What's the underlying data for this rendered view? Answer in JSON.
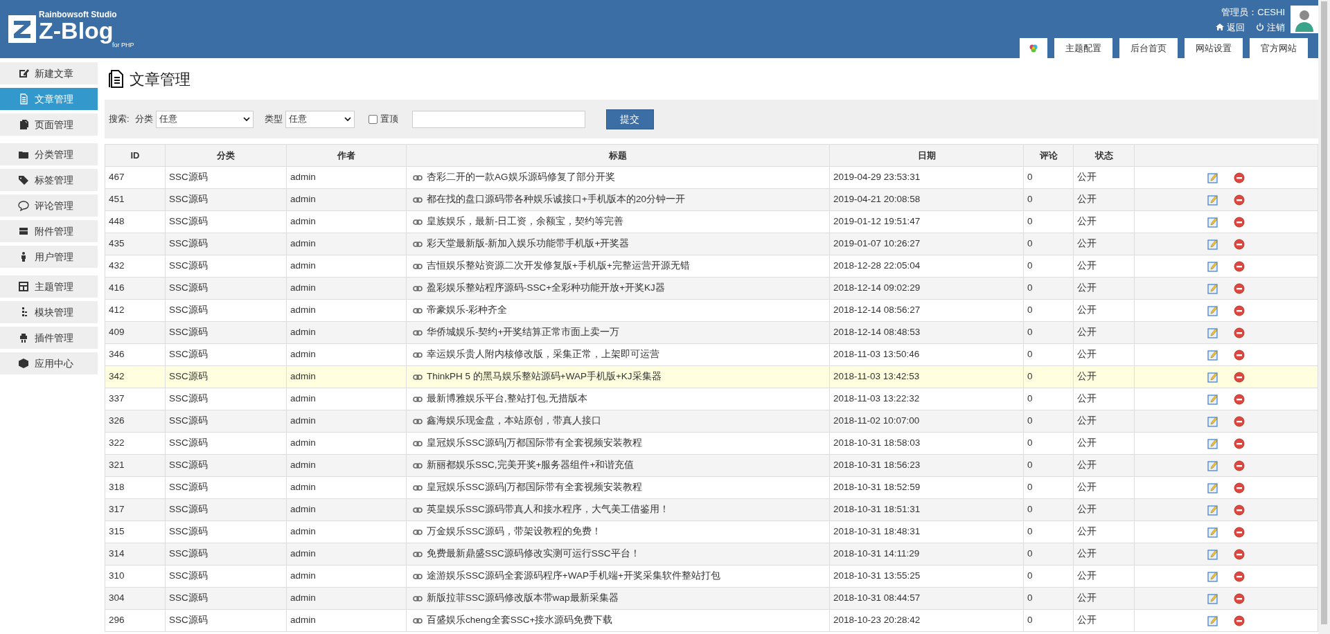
{
  "header": {
    "logo": {
      "studio": "Rainbowsoft Studio",
      "name": "Z-Blog",
      "sub": "for PHP"
    },
    "user_label": "管理员：CESHI",
    "back": "返回",
    "logout": "注销",
    "tabs": [
      {
        "kind": "icon"
      },
      {
        "kind": "text",
        "label": "主题配置"
      },
      {
        "kind": "text",
        "label": "后台首页"
      },
      {
        "kind": "text",
        "label": "网站设置"
      },
      {
        "kind": "text",
        "label": "官方网站"
      }
    ]
  },
  "sidebar": {
    "groups": [
      [
        {
          "label": "新建文章",
          "selected": false
        },
        {
          "label": "文章管理",
          "selected": true
        },
        {
          "label": "页面管理",
          "selected": false
        }
      ],
      [
        {
          "label": "分类管理",
          "selected": false
        },
        {
          "label": "标签管理",
          "selected": false
        },
        {
          "label": "评论管理",
          "selected": false
        },
        {
          "label": "附件管理",
          "selected": false
        },
        {
          "label": "用户管理",
          "selected": false
        }
      ],
      [
        {
          "label": "主题管理",
          "selected": false
        },
        {
          "label": "模块管理",
          "selected": false
        },
        {
          "label": "插件管理",
          "selected": false
        },
        {
          "label": "应用中心",
          "selected": false
        }
      ]
    ]
  },
  "page_title": "文章管理",
  "search": {
    "label": "搜索:",
    "category_label": "分类",
    "category_value": "任意",
    "type_label": "类型",
    "type_value": "任意",
    "pinned_label": "置顶",
    "pinned_checked": false,
    "submit": "提交"
  },
  "table": {
    "columns": [
      "ID",
      "分类",
      "作者",
      "标题",
      "日期",
      "评论",
      "状态"
    ],
    "rows": [
      {
        "id": "467",
        "category": "SSC源码",
        "author": "admin",
        "title": "杏彩二开的一款AG娱乐源码修复了部分开奖",
        "date": "2019-04-29 23:53:31",
        "comments": "0",
        "status": "公开",
        "highlighted": false
      },
      {
        "id": "451",
        "category": "SSC源码",
        "author": "admin",
        "title": "都在找的盘口源码带各种娱乐诚接口+手机版本的20分钟一开",
        "date": "2019-04-21 20:08:58",
        "comments": "0",
        "status": "公开",
        "highlighted": false
      },
      {
        "id": "448",
        "category": "SSC源码",
        "author": "admin",
        "title": "皇族娱乐，最新-日工资，余额宝，契约等完善",
        "date": "2019-01-12 19:51:47",
        "comments": "0",
        "status": "公开",
        "highlighted": false
      },
      {
        "id": "435",
        "category": "SSC源码",
        "author": "admin",
        "title": "彩天堂最新版-新加入娱乐功能带手机版+开奖器",
        "date": "2019-01-07 10:26:27",
        "comments": "0",
        "status": "公开",
        "highlighted": false
      },
      {
        "id": "432",
        "category": "SSC源码",
        "author": "admin",
        "title": "吉恒娱乐整站资源二次开发修复版+手机版+完整运营开源无错",
        "date": "2018-12-28 22:05:04",
        "comments": "0",
        "status": "公开",
        "highlighted": false
      },
      {
        "id": "416",
        "category": "SSC源码",
        "author": "admin",
        "title": "盈彩娱乐整站程序源码-SSC+全彩种功能开放+开奖KJ器",
        "date": "2018-12-14 09:02:29",
        "comments": "0",
        "status": "公开",
        "highlighted": false
      },
      {
        "id": "412",
        "category": "SSC源码",
        "author": "admin",
        "title": "帝豪娱乐-彩种齐全",
        "date": "2018-12-14 08:56:27",
        "comments": "0",
        "status": "公开",
        "highlighted": false
      },
      {
        "id": "409",
        "category": "SSC源码",
        "author": "admin",
        "title": "华侨城娱乐-契约+开奖结算正常市面上卖一万",
        "date": "2018-12-14 08:48:53",
        "comments": "0",
        "status": "公开",
        "highlighted": false
      },
      {
        "id": "346",
        "category": "SSC源码",
        "author": "admin",
        "title": "幸运娱乐贵人附内核修改版，采集正常，上架即可运营",
        "date": "2018-11-03 13:50:46",
        "comments": "0",
        "status": "公开",
        "highlighted": false
      },
      {
        "id": "342",
        "category": "SSC源码",
        "author": "admin",
        "title": "ThinkPH 5 的黑马娱乐整站源码+WAP手机版+KJ采集器",
        "date": "2018-11-03 13:42:53",
        "comments": "0",
        "status": "公开",
        "highlighted": true
      },
      {
        "id": "337",
        "category": "SSC源码",
        "author": "admin",
        "title": "最新博雅娱乐平台,整站打包,无措版本",
        "date": "2018-11-03 13:22:32",
        "comments": "0",
        "status": "公开",
        "highlighted": false
      },
      {
        "id": "326",
        "category": "SSC源码",
        "author": "admin",
        "title": "鑫海娱乐现金盘，本站原创，带真人接口",
        "date": "2018-11-02 10:07:00",
        "comments": "0",
        "status": "公开",
        "highlighted": false
      },
      {
        "id": "322",
        "category": "SSC源码",
        "author": "admin",
        "title": "皇冠娱乐SSC源码|万都国际带有全套视频安装教程",
        "date": "2018-10-31 18:58:03",
        "comments": "0",
        "status": "公开",
        "highlighted": false
      },
      {
        "id": "321",
        "category": "SSC源码",
        "author": "admin",
        "title": "新丽都娱乐SSC,完美开奖+服务器组件+和谐充值",
        "date": "2018-10-31 18:56:23",
        "comments": "0",
        "status": "公开",
        "highlighted": false
      },
      {
        "id": "318",
        "category": "SSC源码",
        "author": "admin",
        "title": "皇冠娱乐SSC源码|万都国际带有全套视频安装教程",
        "date": "2018-10-31 18:52:59",
        "comments": "0",
        "status": "公开",
        "highlighted": false
      },
      {
        "id": "317",
        "category": "SSC源码",
        "author": "admin",
        "title": "英皇娱乐SSC源码带真人和接水程序，大气美工借鉴用！",
        "date": "2018-10-31 18:51:31",
        "comments": "0",
        "status": "公开",
        "highlighted": false
      },
      {
        "id": "315",
        "category": "SSC源码",
        "author": "admin",
        "title": "万金娱乐SSC源码，带架设教程的免费！",
        "date": "2018-10-31 18:48:31",
        "comments": "0",
        "status": "公开",
        "highlighted": false
      },
      {
        "id": "314",
        "category": "SSC源码",
        "author": "admin",
        "title": "免费最新鼎盛SSC源码修改实测可运行SSC平台！",
        "date": "2018-10-31 14:11:29",
        "comments": "0",
        "status": "公开",
        "highlighted": false
      },
      {
        "id": "310",
        "category": "SSC源码",
        "author": "admin",
        "title": "途游娱乐SSC源码全套源码程序+WAP手机端+开奖采集软件整站打包",
        "date": "2018-10-31 13:55:25",
        "comments": "0",
        "status": "公开",
        "highlighted": false
      },
      {
        "id": "304",
        "category": "SSC源码",
        "author": "admin",
        "title": "新版拉菲SSC源码修改版本带wap最新采集器",
        "date": "2018-10-31 08:44:57",
        "comments": "0",
        "status": "公开",
        "highlighted": false
      },
      {
        "id": "296",
        "category": "SSC源码",
        "author": "admin",
        "title": "百盛娱乐cheng全套SSC+接水源码免费下载",
        "date": "2018-10-23 20:28:42",
        "comments": "0",
        "status": "公开",
        "highlighted": false
      }
    ]
  }
}
